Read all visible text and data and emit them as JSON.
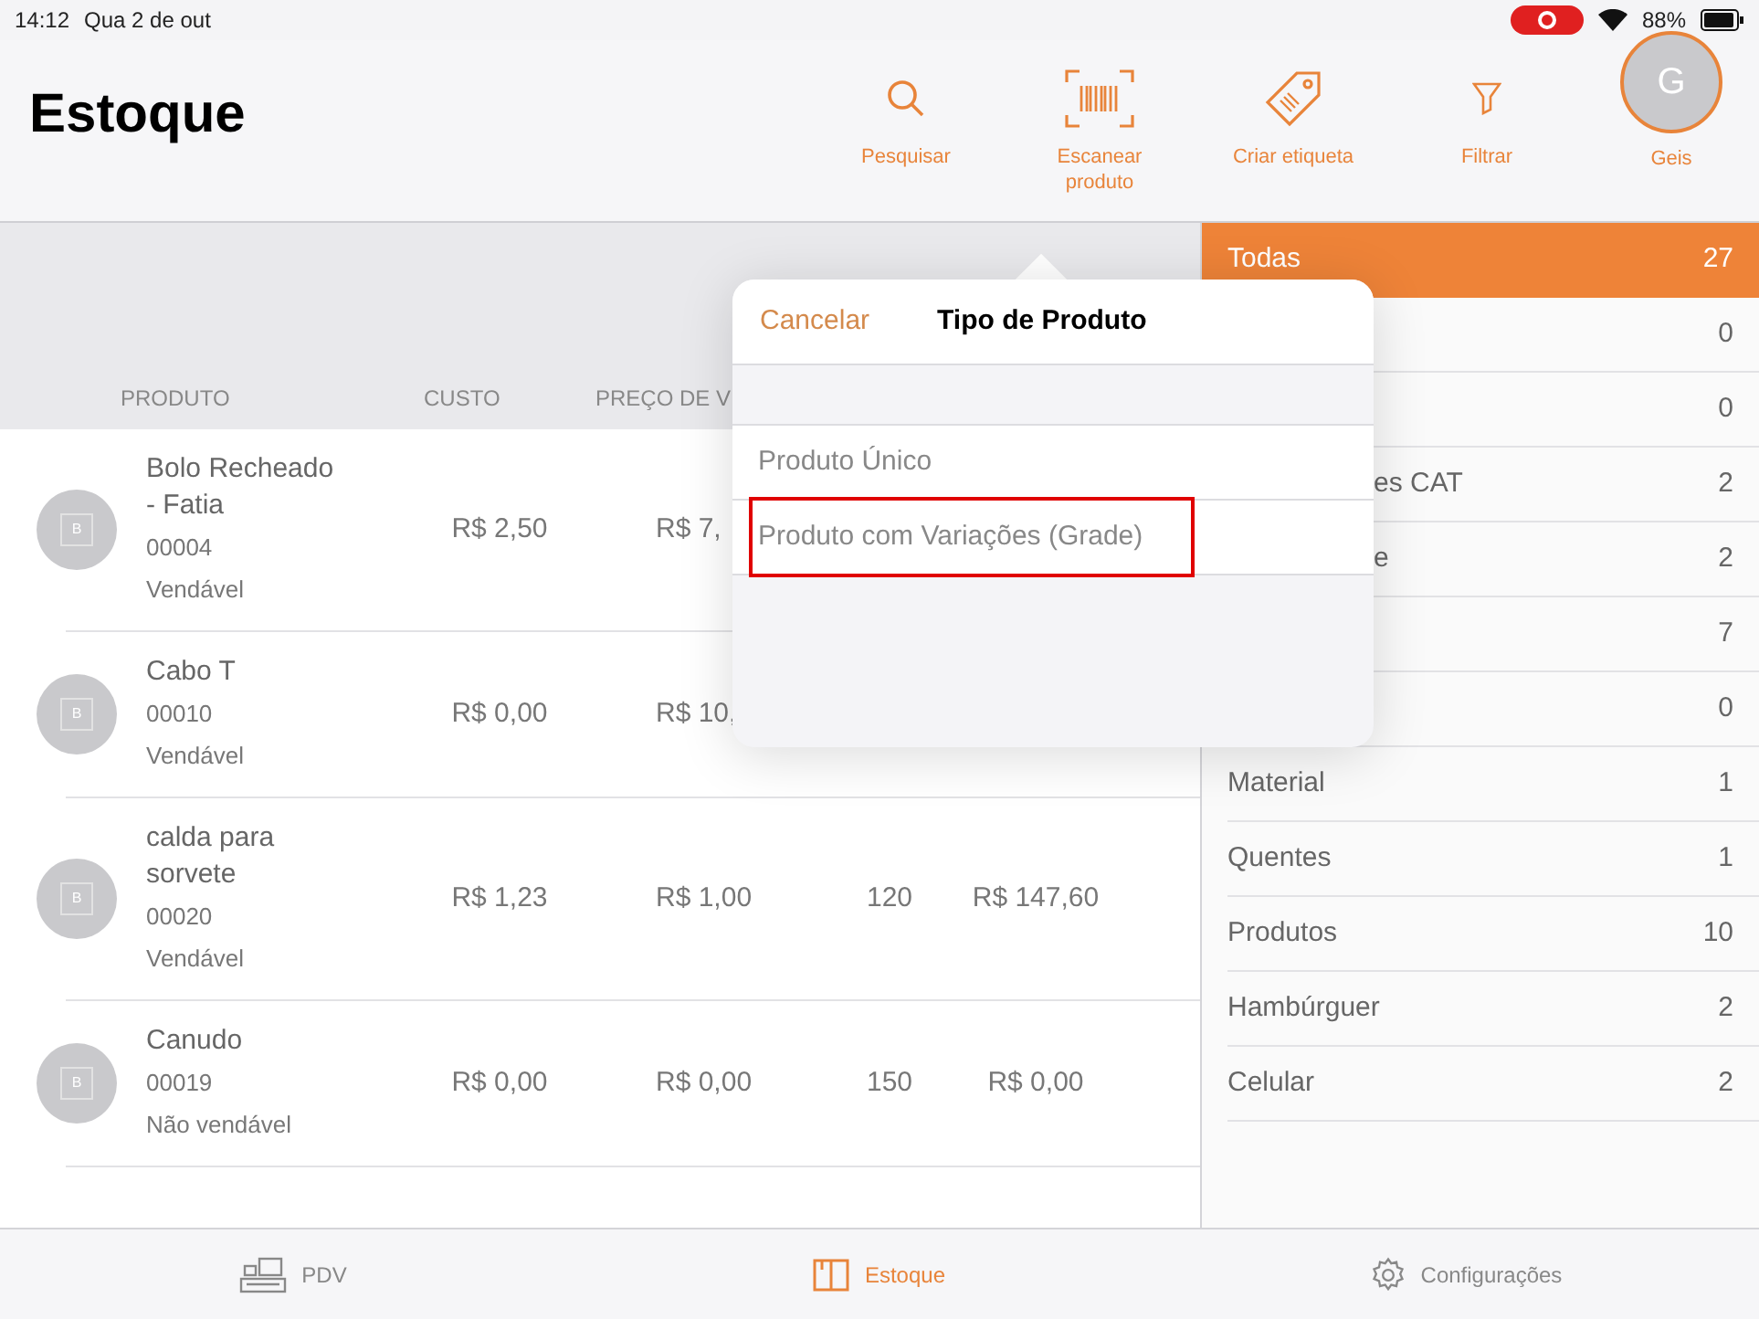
{
  "status_bar": {
    "time": "14:12",
    "date": "Qua 2 de out",
    "recording": true,
    "battery": "88%"
  },
  "header": {
    "title": "Estoque",
    "actions": [
      {
        "kind": "search",
        "label": "Pesquisar"
      },
      {
        "kind": "barcode",
        "label": "Escanear produto"
      },
      {
        "kind": "tag",
        "label": "Criar etiqueta"
      },
      {
        "kind": "filter",
        "label": "Filtrar"
      }
    ],
    "user": {
      "initial": "G",
      "name": "Geis"
    }
  },
  "table": {
    "columns": [
      "PRODUTO",
      "CUSTO",
      "PREÇO DE V"
    ],
    "rows": [
      {
        "name": "Bolo Recheado - Fatia",
        "code": "00004",
        "status": "Vendável",
        "avatar": "B",
        "cost": "R$ 2,50",
        "price": "R$ 7,"
      },
      {
        "name": "Cabo T",
        "code": "00010",
        "status": "Vendável",
        "avatar": "B",
        "cost": "R$ 0,00",
        "price": "R$ 10,"
      },
      {
        "name": "calda para sorvete",
        "code": "00020",
        "status": "Vendável",
        "avatar": "B",
        "cost": "R$ 1,23",
        "price": "R$ 1,00",
        "quantity": "120",
        "total": "R$ 147,60"
      },
      {
        "name": "Canudo",
        "code": "00019",
        "status": "Não vendável",
        "avatar": "B",
        "cost": "R$ 0,00",
        "price": "R$ 0,00",
        "quantity": "150",
        "total": "R$ 0,00"
      }
    ]
  },
  "categories": [
    {
      "kind": "full",
      "label": "Todas",
      "count": "27",
      "selected": true
    },
    {
      "count": "0",
      "selected": false
    },
    {
      "count": "0",
      "selected": false
    },
    {
      "kind": "partial",
      "label": "es CAT",
      "count": "2",
      "selected": false
    },
    {
      "kind": "partial",
      "label": "e",
      "count": "2",
      "selected": false
    },
    {
      "count": "7",
      "selected": false
    },
    {
      "count": "0",
      "selected": false
    },
    {
      "kind": "full",
      "label": "Material",
      "count": "1",
      "selected": false
    },
    {
      "kind": "full",
      "label": "Quentes",
      "count": "1",
      "selected": false
    },
    {
      "kind": "full",
      "label": "Produtos",
      "count": "10",
      "selected": false
    },
    {
      "kind": "full",
      "label": "Hambúrguer",
      "count": "2",
      "selected": false
    },
    {
      "kind": "full",
      "label": "Celular",
      "count": "2",
      "selected": false
    }
  ],
  "popover": {
    "cancel": "Cancelar",
    "title": "Tipo de Produto",
    "options": [
      {
        "label": "Produto Único",
        "highlighted": false
      },
      {
        "label": "Produto com Variações (Grade)",
        "highlighted": true
      }
    ]
  },
  "tab_bar": [
    {
      "kind": "pos",
      "label": "PDV",
      "selected": false
    },
    {
      "kind": "stock",
      "label": "Estoque",
      "selected": true
    },
    {
      "kind": "settings",
      "label": "Configurações",
      "selected": false
    }
  ]
}
